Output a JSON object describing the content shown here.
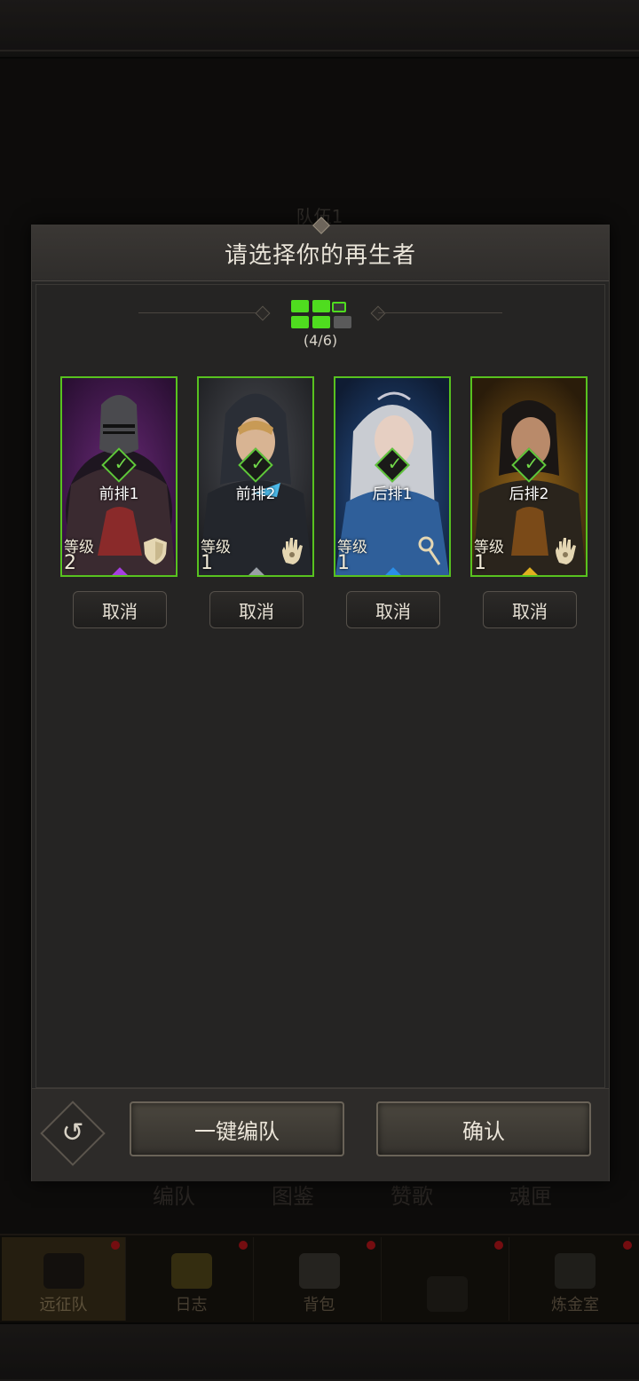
{
  "background": {
    "team_title": "队伍1",
    "subtabs": [
      "编队",
      "图鉴",
      "赞歌",
      "魂匣"
    ],
    "nav": [
      {
        "label": "远征队",
        "icon": "skull-helmet-icon",
        "active": true,
        "badge": true
      },
      {
        "label": "日志",
        "icon": "scroll-icon",
        "active": false,
        "badge": true
      },
      {
        "label": "背包",
        "icon": "bag-icon",
        "active": false,
        "badge": true
      },
      {
        "label": "",
        "icon": "locked-icon",
        "active": false,
        "badge": true
      },
      {
        "label": "炼金室",
        "icon": "alchemy-icon",
        "active": false,
        "badge": true
      }
    ]
  },
  "modal": {
    "title": "请选择你的再生者",
    "progress": {
      "filled": 4,
      "total": 6,
      "text": "(4/6)"
    },
    "cards": [
      {
        "position": "前排1",
        "level_label": "等级",
        "level": "2",
        "class_icon": "shield-icon",
        "rarity_color": "#a53ee0",
        "cancel": "取消"
      },
      {
        "position": "前排2",
        "level_label": "等级",
        "level": "1",
        "class_icon": "hand-icon",
        "rarity_color": "#9aa0a6",
        "cancel": "取消"
      },
      {
        "position": "后排1",
        "level_label": "等级",
        "level": "1",
        "class_icon": "staff-icon",
        "rarity_color": "#2a8ee8",
        "cancel": "取消"
      },
      {
        "position": "后排2",
        "level_label": "等级",
        "level": "1",
        "class_icon": "hand-icon",
        "rarity_color": "#e0b020",
        "cancel": "取消"
      }
    ],
    "auto_button": "一键编队",
    "confirm_button": "确认"
  },
  "colors": {
    "accent_green": "#4fdc1f",
    "badge_red": "#b3141a"
  }
}
